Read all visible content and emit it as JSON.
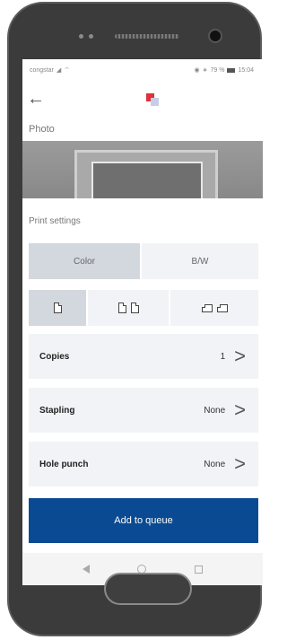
{
  "status_bar": {
    "carrier": "congstar",
    "battery_percent": "79 %",
    "time": "15:04"
  },
  "header": {
    "title": "Photo"
  },
  "print_settings": {
    "section_title": "Print settings",
    "color_mode": {
      "options": [
        "Color",
        "B/W"
      ],
      "selected": "Color"
    },
    "layout": {
      "options": [
        "single-page-icon",
        "two-pages-icon",
        "landscape-two-pages-icon"
      ],
      "selected": "single-page-icon"
    },
    "rows": [
      {
        "label": "Copies",
        "value": "1"
      },
      {
        "label": "Stapling",
        "value": "None"
      },
      {
        "label": "Hole punch",
        "value": "None"
      }
    ]
  },
  "actions": {
    "add_to_queue": "Add to queue"
  },
  "colors": {
    "primary": "#0a4a92",
    "selected_segment": "#d3d8de",
    "row_background": "#f2f3f6",
    "logo_red": "#e0323c"
  }
}
